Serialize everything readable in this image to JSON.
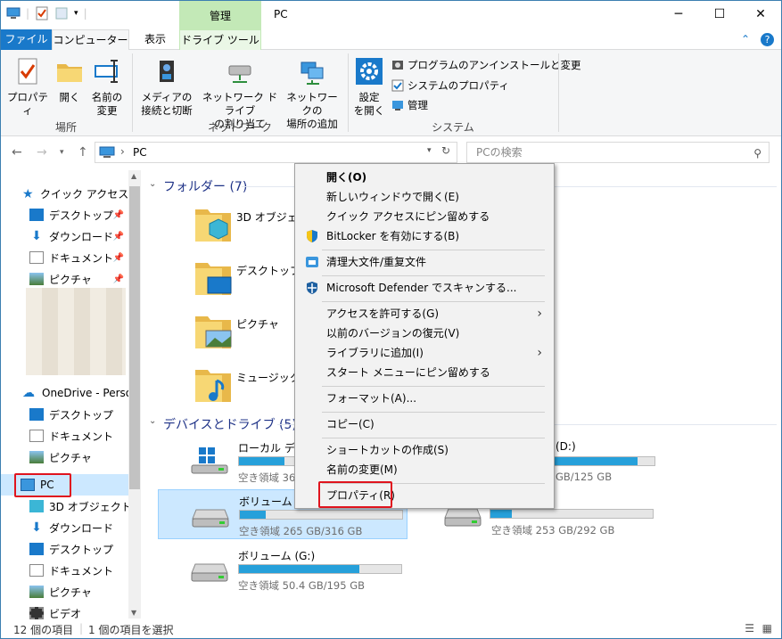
{
  "titlebar": {
    "title": "PC",
    "manage_tab": "管理",
    "minimize": "─",
    "maximize": "☐",
    "close": "✕"
  },
  "tabs": {
    "file": "ファイル",
    "computer": "コンピューター",
    "view": "表示",
    "drive_tools": "ドライブ ツール",
    "chevron": "⌃",
    "help": "?"
  },
  "ribbon": {
    "location": {
      "label": "場所",
      "properties": "プロパティ",
      "open": "開く",
      "rename_1": "名前の",
      "rename_2": "変更"
    },
    "network": {
      "label": "ネットワーク",
      "media_1": "メディアの",
      "media_2": "接続と切断",
      "map_1": "ネットワーク ドライブ",
      "map_2": "の割り当て",
      "add_1": "ネットワークの",
      "add_2": "場所の追加"
    },
    "system": {
      "label": "システム",
      "settings_1": "設定",
      "settings_2": "を開く",
      "uninstall": "プログラムのアンインストールと変更",
      "sysprops": "システムのプロパティ",
      "manage": "管理"
    }
  },
  "address": {
    "path": "PC",
    "separator": "›",
    "search_placeholder": "PCの検索"
  },
  "sidebar": {
    "quick_access": "クイック アクセス",
    "qa_items": [
      "デスクトップ",
      "ダウンロード",
      "ドキュメント",
      "ピクチャ"
    ],
    "onedrive": "OneDrive - Persor",
    "od_items": [
      "デスクトップ",
      "ドキュメント",
      "ピクチャ"
    ],
    "pc": "PC",
    "pc_items": [
      "3D オブジェクト",
      "ダウンロード",
      "デスクトップ",
      "ドキュメント",
      "ピクチャ",
      "ビデオ"
    ]
  },
  "main": {
    "folders_header": "フォルダー (7)",
    "folders": [
      "3D オブジェク",
      "デスクトップ",
      "ピクチャ",
      "ミュージック"
    ],
    "devices_header": "デバイスとドライブ (5)",
    "drives": [
      {
        "name": "ローカル ディス",
        "free": "空き領域 367",
        "usage": 0.28
      },
      {
        "name": "(D:)",
        "free": "空き領域 GB/125 GB",
        "usage": 0.83
      },
      {
        "name": "ボリューム (E:)",
        "free": "空き領域 265 GB/316 GB",
        "usage": 0.16
      },
      {
        "name": "",
        "free": "空き領域 253 GB/292 GB",
        "usage": 0.13
      },
      {
        "name": "ボリューム (G:)",
        "free": "空き領域 50.4 GB/195 GB",
        "usage": 0.74
      }
    ],
    "d_label": "(D:)",
    "d_free": "GB/125 GB"
  },
  "context_menu": {
    "items": [
      "開く(O)",
      "新しいウィンドウで開く(E)",
      "クイック アクセスにピン留めする",
      "BitLocker を有効にする(B)",
      "清理大文件/重复文件",
      "Microsoft Defender でスキャンする...",
      "アクセスを許可する(G)",
      "以前のバージョンの復元(V)",
      "ライブラリに追加(I)",
      "スタート メニューにピン留めする",
      "フォーマット(A)...",
      "コピー(C)",
      "ショートカットの作成(S)",
      "名前の変更(M)",
      "プロパティ(R)"
    ],
    "submenu_arrow": "›"
  },
  "statusbar": {
    "count": "12 個の項目",
    "selected": "1 個の項目を選択"
  },
  "colors": {
    "accent": "#1979ca",
    "manage": "#c3e9b7",
    "highlight": "#e0141e",
    "bar": "#26a0da"
  }
}
